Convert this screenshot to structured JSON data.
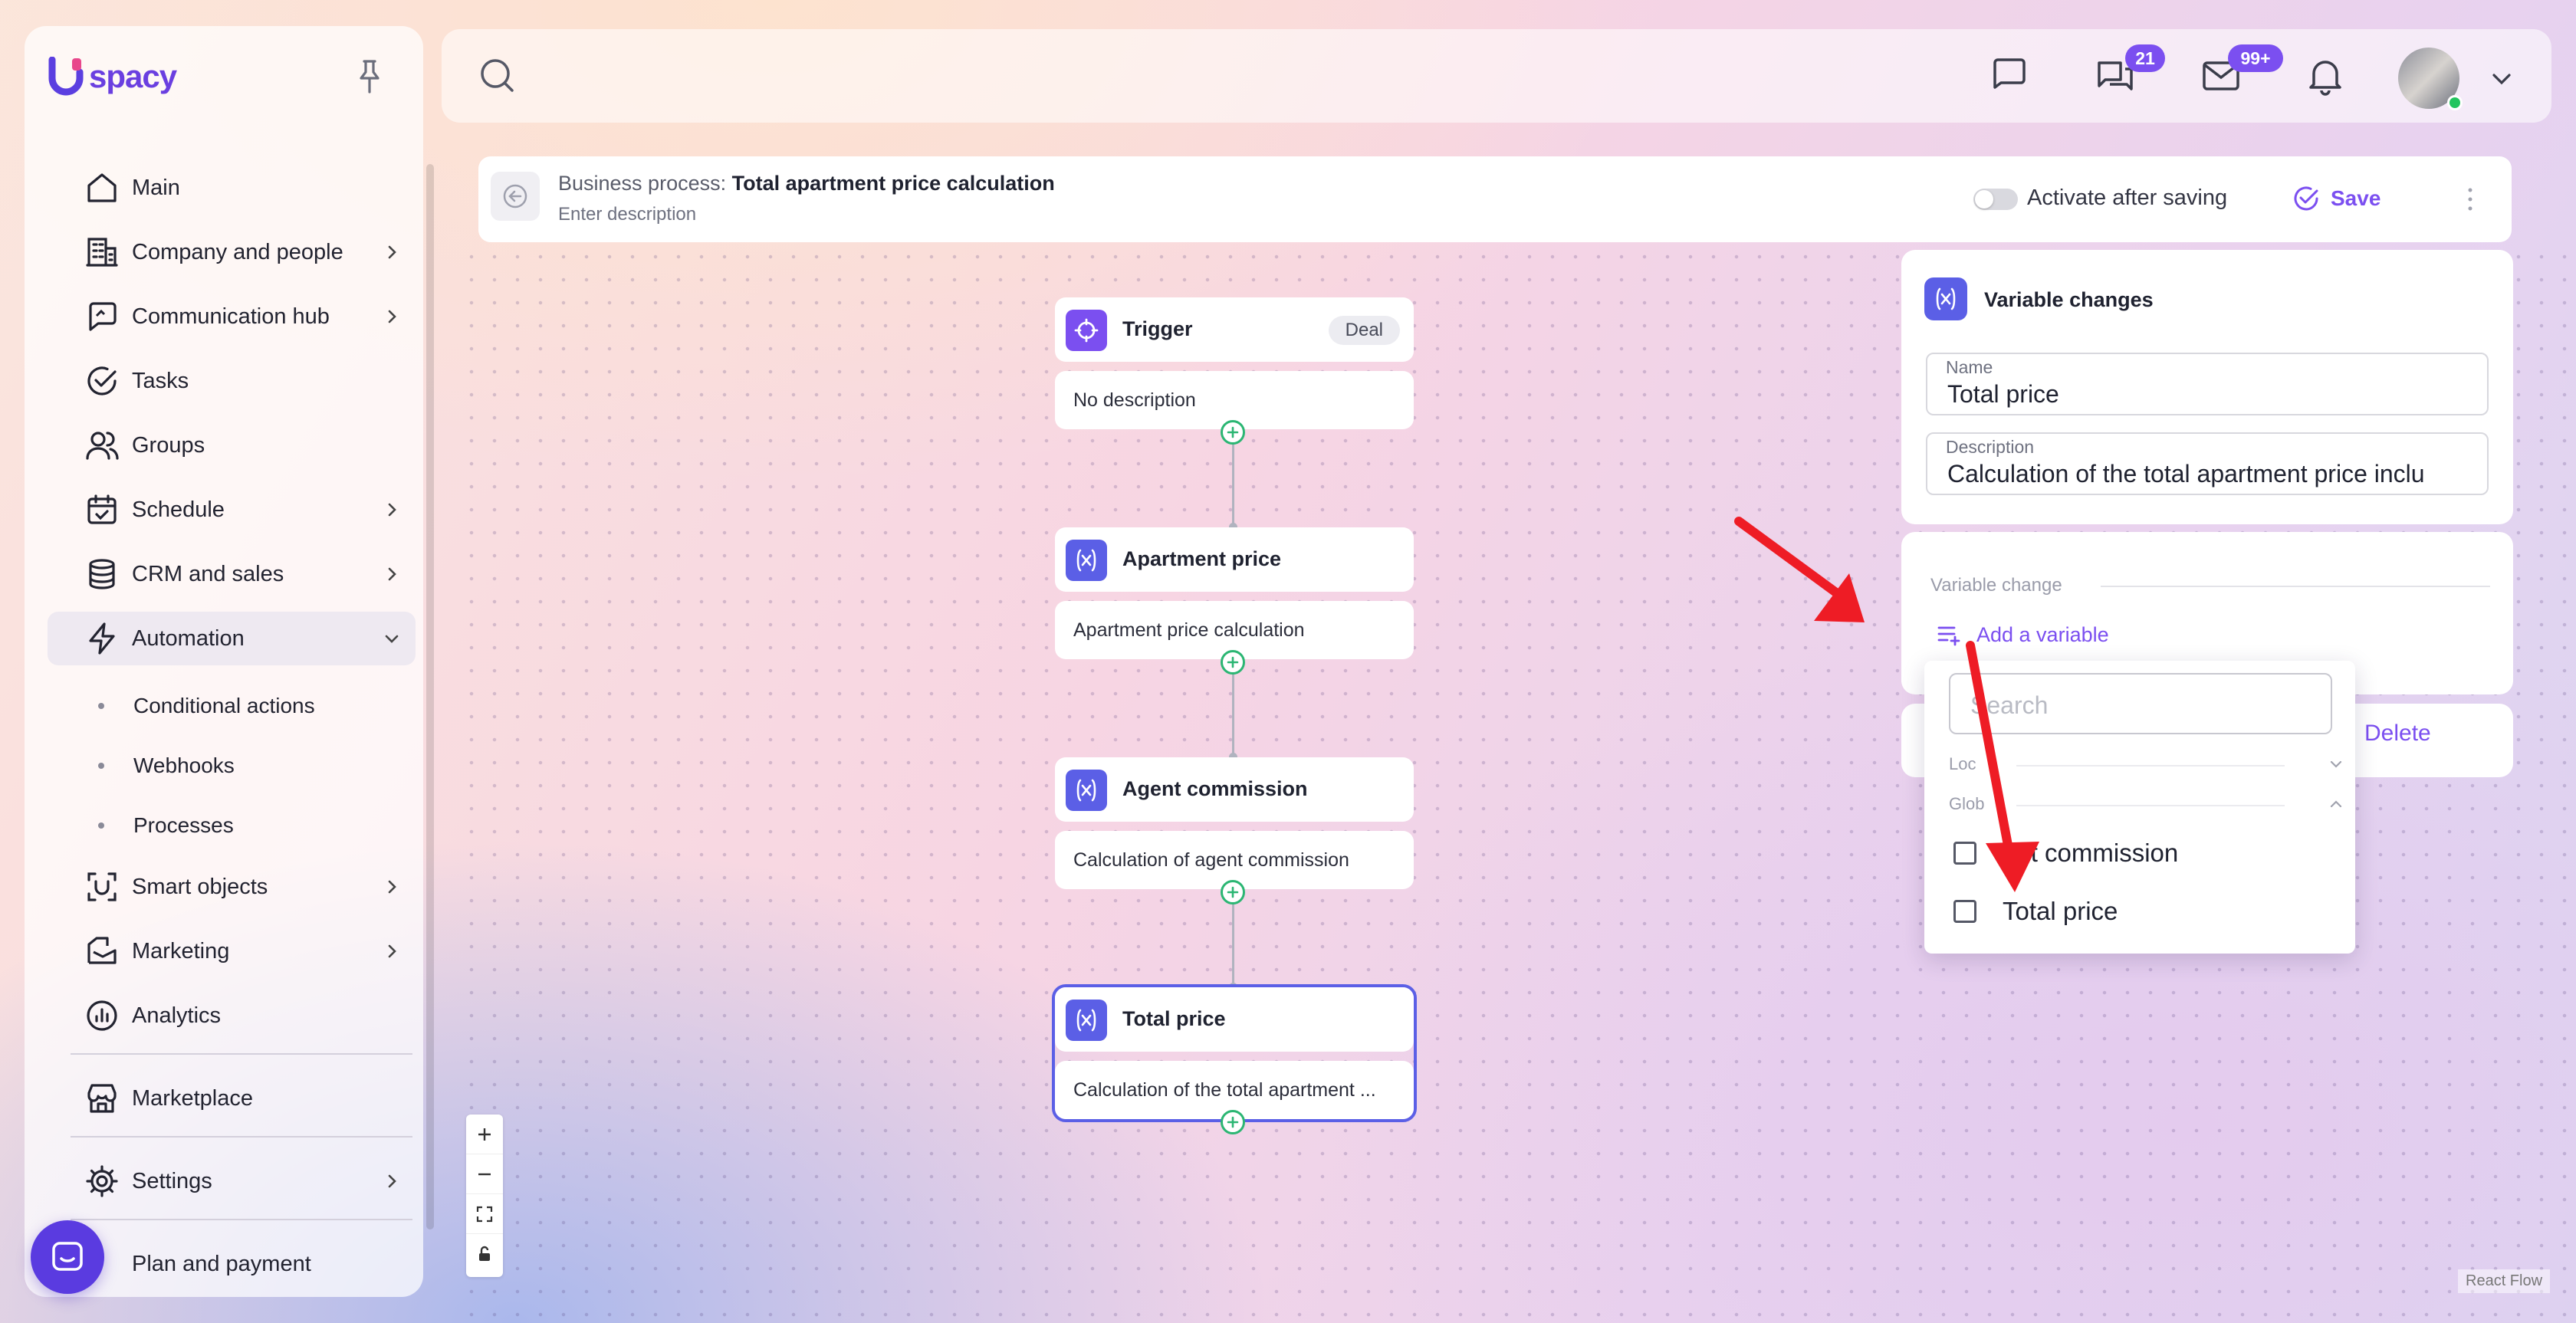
{
  "app": {
    "logo_text": "spacy",
    "brand_color": "#6a3fe0",
    "accent_color": "#7b4ff0"
  },
  "sidebar": {
    "items": [
      {
        "label": "Main",
        "icon": "home-icon"
      },
      {
        "label": "Company and people",
        "icon": "building-icon"
      },
      {
        "label": "Communication hub",
        "icon": "chat-icon"
      },
      {
        "label": "Tasks",
        "icon": "check-circle-icon"
      },
      {
        "label": "Groups",
        "icon": "users-icon"
      },
      {
        "label": "Schedule",
        "icon": "calendar-icon"
      },
      {
        "label": "CRM and sales",
        "icon": "database-icon"
      },
      {
        "label": "Automation",
        "icon": "lightning-icon"
      }
    ],
    "automation_sub": [
      "Conditional actions",
      "Webhooks",
      "Processes"
    ],
    "items2": [
      {
        "label": "Smart objects",
        "icon": "scan-icon"
      },
      {
        "label": "Marketing",
        "icon": "marketing-icon"
      },
      {
        "label": "Analytics",
        "icon": "chart-icon"
      }
    ],
    "marketplace": "Marketplace",
    "settings": "Settings",
    "plan": "Plan and payment"
  },
  "topbar": {
    "chats_badge": "21",
    "mail_badge": "99+"
  },
  "process": {
    "prefix": "Business process:",
    "title": "Total apartment price calculation",
    "description": "Enter description",
    "activate_label": "Activate after saving",
    "save_label": "Save"
  },
  "nodes": [
    {
      "title": "Trigger",
      "tag": "Deal",
      "body": "No description"
    },
    {
      "title": "Apartment price",
      "body": "Apartment price calculation"
    },
    {
      "title": "Agent commission",
      "body": "Calculation of agent commission"
    },
    {
      "title": "Total price",
      "body": "Calculation of the total apartment ..."
    }
  ],
  "panel": {
    "title": "Variable changes",
    "name_label": "Name",
    "name_value": "Total price",
    "desc_label": "Description",
    "desc_value": "Calculation of the total apartment price inclu",
    "section_label": "Variable change",
    "add_variable": "Add a variable",
    "delete_label": "Delete"
  },
  "dropdown": {
    "search_placeholder": "Search",
    "group_local": "Loc",
    "group_global": "Glob",
    "items": [
      "ent commission",
      "Total price"
    ]
  },
  "attribution": "React Flow"
}
